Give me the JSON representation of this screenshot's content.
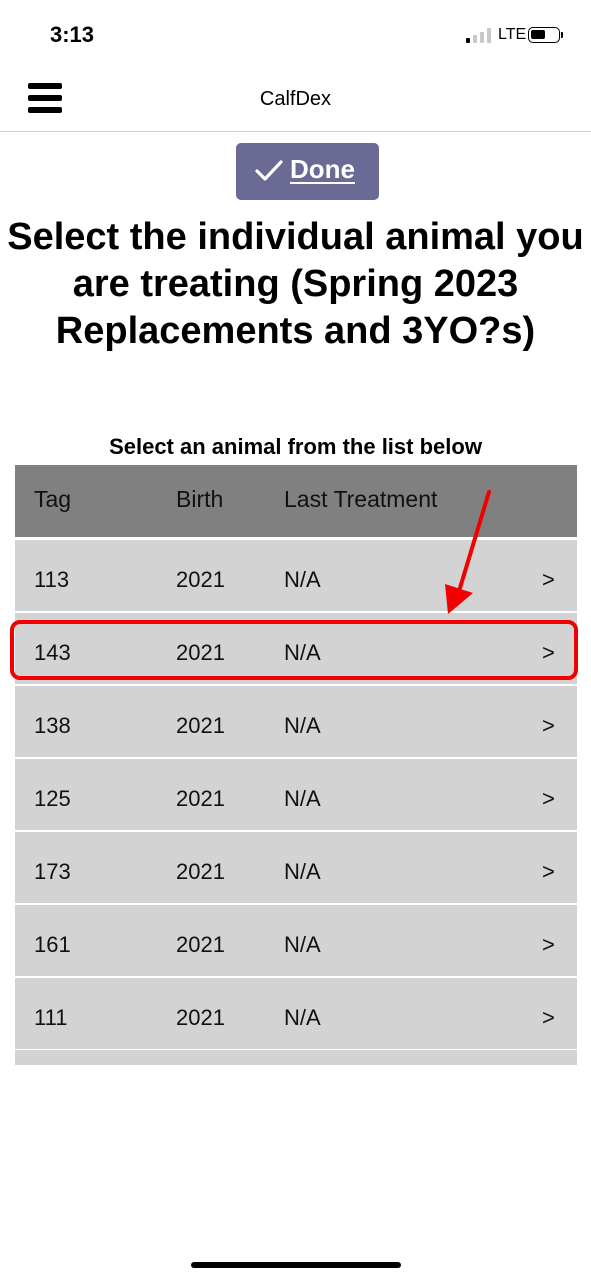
{
  "status_bar": {
    "time": "3:13",
    "network": "LTE"
  },
  "header": {
    "title": "CalfDex",
    "menu_icon": "hamburger-menu-icon"
  },
  "done_button": {
    "label": "Done",
    "icon": "checkmark-icon"
  },
  "page_title": "Select the individual animal you are treating (Spring 2023 Replacements and 3YO?s)",
  "instruction": "Select an animal from the list below",
  "table": {
    "columns": [
      "Tag",
      "Birth",
      "Last Treatment"
    ],
    "rows": [
      {
        "tag": "113",
        "birth": "2021",
        "last_treatment": "N/A",
        "chevron": ">"
      },
      {
        "tag": "143",
        "birth": "2021",
        "last_treatment": "N/A",
        "chevron": ">"
      },
      {
        "tag": "138",
        "birth": "2021",
        "last_treatment": "N/A",
        "chevron": ">"
      },
      {
        "tag": "125",
        "birth": "2021",
        "last_treatment": "N/A",
        "chevron": ">"
      },
      {
        "tag": "173",
        "birth": "2021",
        "last_treatment": "N/A",
        "chevron": ">"
      },
      {
        "tag": "161",
        "birth": "2021",
        "last_treatment": "N/A",
        "chevron": ">"
      },
      {
        "tag": "111",
        "birth": "2021",
        "last_treatment": "N/A",
        "chevron": ">"
      }
    ]
  },
  "annotation": {
    "highlight_color": "#f00000",
    "highlighted_tag": "143"
  },
  "colors": {
    "accent": "#6a6a94",
    "table_header": "#808080",
    "row": "#d3d3d3"
  }
}
